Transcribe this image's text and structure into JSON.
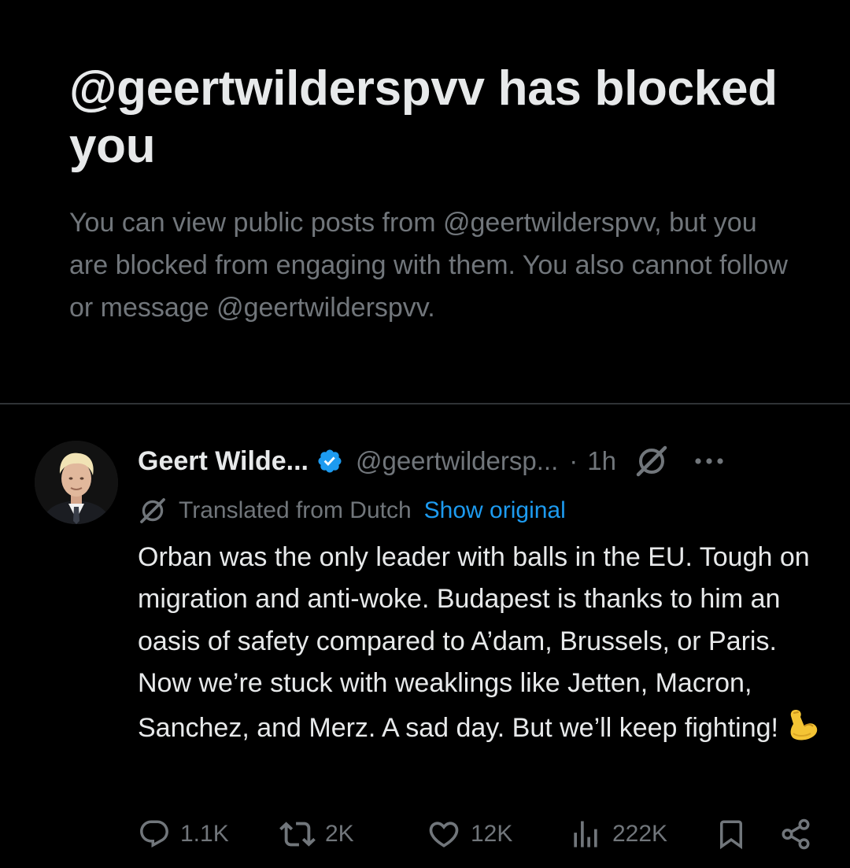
{
  "block_notice": {
    "title": "@geertwilderspvv has blocked you",
    "description": "You can view public posts from @geertwilderspvv, but you are blocked from engaging with them. You also cannot follow or message @geertwilderspvv."
  },
  "post": {
    "author_name": "Geert Wilde...",
    "verified": true,
    "verified_color": "#1d9bf0",
    "handle": "@geertwildersp...",
    "separator": "·",
    "time": "1h",
    "translation_label": "Translated from Dutch",
    "show_original_label": "Show original",
    "text": "Orban was the only leader with balls in the EU. Tough on migration and anti-woke. Budapest is thanks to him an oasis of safety compared to A’dam, Brussels, or Paris. Now we’re stuck with weaklings like Jetten, Macron, Sanchez, and Merz. A sad day. But we’ll keep fighting!",
    "emoji": "flexed-biceps",
    "stats": {
      "replies": "1.1K",
      "reposts": "2K",
      "likes": "12K",
      "views": "222K"
    }
  },
  "colors": {
    "background": "#000000",
    "primary_text": "#e7e9ea",
    "secondary_text": "#71767b",
    "link": "#1d9bf0",
    "divider": "#2f3336"
  },
  "icons": [
    "verified-badge-icon",
    "grok-icon",
    "more-icon",
    "translate-icon",
    "reply-icon",
    "repost-icon",
    "like-icon",
    "views-icon",
    "bookmark-icon",
    "share-icon"
  ]
}
